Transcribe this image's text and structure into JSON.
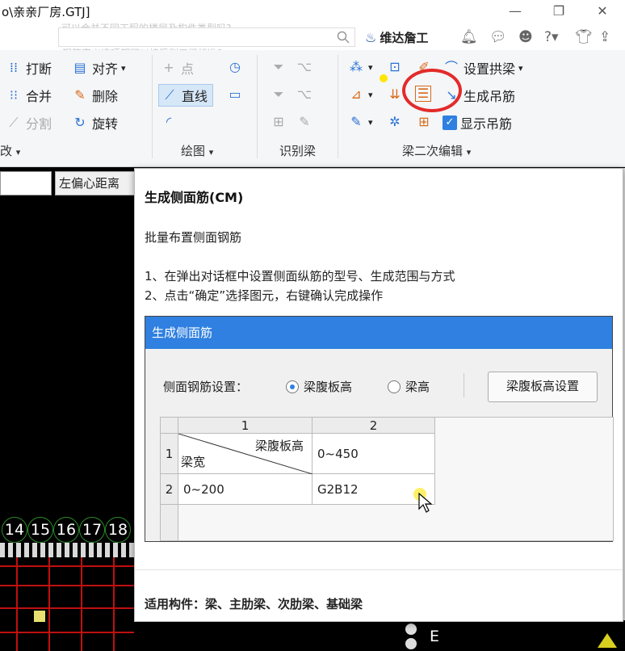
{
  "window": {
    "title": "o\\亲亲厂房.GTJ]",
    "hint_line1": "可以合并不同工程的楼层及构件类型吗?",
    "hint_line2": "钢筋定义选项都可以接受到口径标准?",
    "brand": "维达詹工",
    "controls": {
      "minimize": "—",
      "restore": "❐",
      "close": "✕"
    }
  },
  "ribbon": {
    "modify": {
      "break_label": "打断",
      "align_label": "对齐",
      "merge_label": "合并",
      "delete_label": "删除",
      "split_label": "分割",
      "rotate_label": "旋转",
      "group_label": "改"
    },
    "draw": {
      "point_label": "点",
      "line_label": "直线",
      "group_label": "绘图"
    },
    "identify": {
      "group_label": "识别梁"
    },
    "beam_edit": {
      "set_arch_label": "设置拱梁",
      "gen_hanger_label": "生成吊筋",
      "show_hanger_label": "显示吊筋",
      "group_label": "梁二次编辑"
    }
  },
  "strip": {
    "offset_label": "左偏心距离"
  },
  "canvas": {
    "axis_numbers": [
      "14",
      "15",
      "16",
      "17",
      "18"
    ],
    "marker_label": "E"
  },
  "tooltip": {
    "title": "生成侧面筋(CM)",
    "description": "批量布置侧面钢筋",
    "step1": "1、在弹出对话框中设置侧面纵筋的型号、生成范围与方式",
    "step2": "2、点击“确定”选择图元，右键确认完成操作",
    "footer": "适用构件：梁、主肋梁、次肋梁、基础梁",
    "dialog": {
      "title": "生成侧面筋",
      "setting_label": "侧面钢筋设置：",
      "radio_web": "梁腹板高",
      "radio_height": "梁高",
      "web_setting_button": "梁腹板高设置",
      "table": {
        "col_headers": [
          "1",
          "2"
        ],
        "row_headers": [
          "1",
          "2"
        ],
        "corner_top": "梁腹板高",
        "corner_bottom": "梁宽",
        "r1c2": "0~450",
        "r2c1": "0~200",
        "r2c2": "G2B12"
      }
    }
  },
  "colors": {
    "accent": "#2f80e0",
    "highlight_circle": "#e32b2b",
    "canvas_bg": "#000000"
  }
}
